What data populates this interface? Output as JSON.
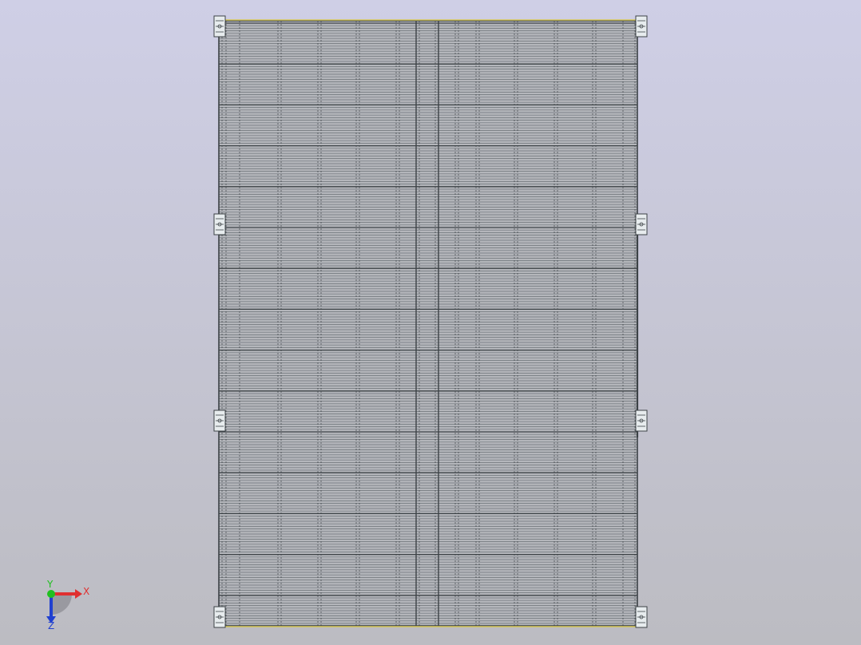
{
  "viewport": {
    "background_top": "#cfcfe6",
    "background_bottom": "#bcbcc2"
  },
  "model": {
    "name": "solar-panel-frame-assembly",
    "frame_color": "#3c4246",
    "line_color": "#6d7278",
    "panel_fill": "#b4b6bb",
    "bracket_color": "#e7ecee",
    "edge_highlight": "#d8c95a"
  },
  "triad": {
    "x_label": "X",
    "y_label": "Y",
    "z_label": "Z",
    "x_color": "#e03030",
    "y_color": "#20c020",
    "z_color": "#2040d0"
  }
}
